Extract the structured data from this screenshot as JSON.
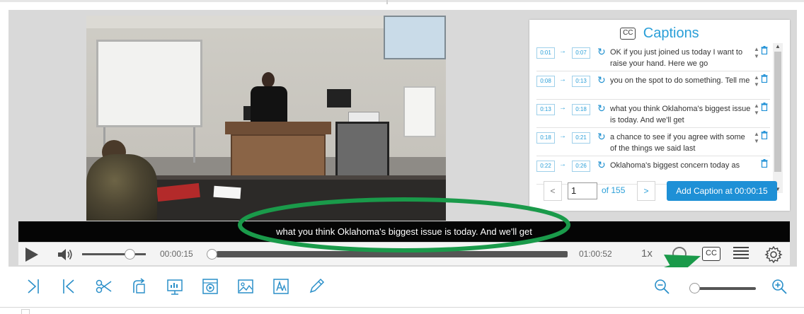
{
  "video": {
    "current_caption": "what you think Oklahoma's biggest issue is today. And we'll get"
  },
  "player": {
    "current_time": "00:00:15",
    "total_time": "01:00:52",
    "speed": "1x",
    "cc_label": "CC",
    "icons": [
      "play-icon",
      "volume-icon",
      "cc-icon",
      "list-icon",
      "gear-icon"
    ]
  },
  "captions_panel": {
    "icon_label": "CC",
    "title": "Captions",
    "rows": [
      {
        "start": "0:01",
        "end": "0:07",
        "text": "OK if you just joined us today I want to raise your hand. Here we go"
      },
      {
        "start": "0:08",
        "end": "0:13",
        "text": "you on the spot to do something. Tell me"
      },
      {
        "start": "0:13",
        "end": "0:18",
        "text": "what you think Oklahoma's biggest issue is today.  And we'll get"
      },
      {
        "start": "0:18",
        "end": "0:21",
        "text": "a chance to see if you agree with some of the things we said last"
      },
      {
        "start": "0:22",
        "end": "0:26",
        "text": "Oklahoma's biggest concern today as"
      }
    ],
    "arrow": "→",
    "pager": {
      "prev": "<",
      "page_value": "1",
      "of_text": "of 155",
      "next": ">"
    },
    "add_button": "Add Caption at 00:00:15"
  },
  "toolbar": {
    "tools": [
      "split-icon",
      "trim-start-icon",
      "scissors-icon",
      "rotate-icon",
      "slides-icon",
      "screen-capture-icon",
      "image-icon",
      "text-overlay-icon",
      "pencil-icon"
    ],
    "zoom_out": "zoom-out-icon",
    "zoom_in": "zoom-in-icon",
    "zoom_level": 0.05
  },
  "colors": {
    "accent": "#2a9fd8",
    "button": "#1e90d6",
    "annotation": "#1a9a4a",
    "icon": "#2a8fc9"
  }
}
